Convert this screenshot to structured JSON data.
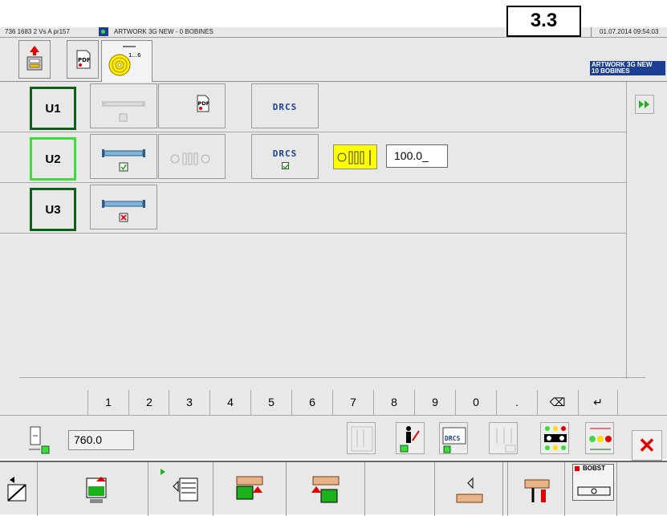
{
  "header": {
    "machine_info": "736 1683 2 Vs A pr157",
    "job_title": "ARTWORK 3G NEW - 0 BOBINES",
    "screen_number": "3.3",
    "datetime": "01.07.2014 09:54:03"
  },
  "toolbar": {
    "job_badge_line1": "ARTWORK 3G NEW",
    "job_badge_line2": "10 BOBINES",
    "icons": [
      "unload-icon",
      "pdf-icon",
      "reel-sequence-icon"
    ],
    "reel_icon_label": "1...6"
  },
  "units": [
    {
      "label": "U1",
      "selected": false
    },
    {
      "label": "U2",
      "selected": true
    },
    {
      "label": "U3",
      "selected": false
    }
  ],
  "dracs_label": "DRCS",
  "pdf_label": "PDF",
  "u2_value": "100.0_",
  "keypad": {
    "keys": [
      "1",
      "2",
      "3",
      "4",
      "5",
      "6",
      "7",
      "8",
      "9",
      "0",
      ".",
      "⌫",
      "↵"
    ]
  },
  "lower": {
    "length_value": "760.0",
    "dracs_small": "DRCS",
    "cancel_symbol": "✕"
  },
  "bottom_nav": {
    "bobst_label": "BOBST"
  },
  "colors": {
    "unit_border": "#0d5f1b",
    "unit_selected_border": "#3ddc3d",
    "dracs_blue": "#1c3f94",
    "highlight_yellow": "#ffff00",
    "cancel_red": "#e00000"
  }
}
